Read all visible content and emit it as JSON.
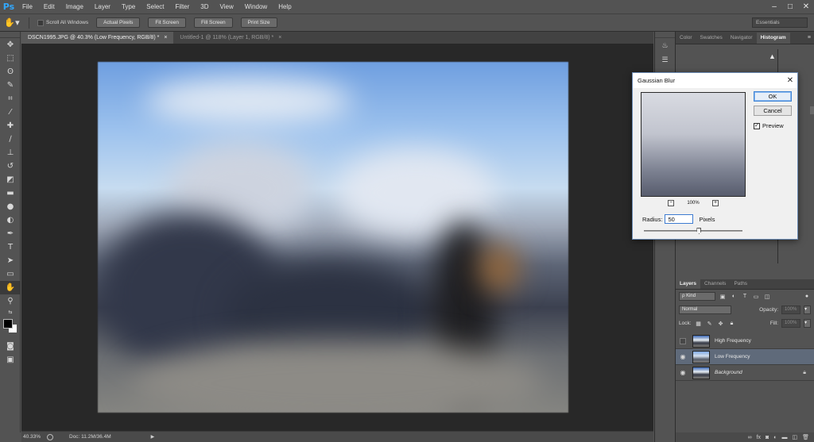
{
  "app": {
    "logo": "Ps",
    "menu": [
      "File",
      "Edit",
      "Image",
      "Layer",
      "Type",
      "Select",
      "Filter",
      "3D",
      "View",
      "Window",
      "Help"
    ],
    "window_controls": [
      "–",
      "□",
      "✕"
    ]
  },
  "options_bar": {
    "scroll_all_windows": "Scroll All Windows",
    "buttons": [
      "Actual Pixels",
      "Fit Screen",
      "Fill Screen",
      "Print Size"
    ],
    "workspace": "Essentials"
  },
  "doc_tabs": [
    {
      "label": "DSCN1995.JPG @ 40.3% (Low Frequency, RGB/8) *",
      "active": true
    },
    {
      "label": "Untitled-1 @ 118% (Layer 1, RGB/8) *",
      "active": false
    }
  ],
  "status": {
    "zoom": "40.33%",
    "doc": "Doc: 11.2M/36.4M",
    "arrow": "▶"
  },
  "panels": {
    "top_tabs": [
      "Color",
      "Swatches",
      "Navigator",
      "Histogram"
    ],
    "active_top_tab": "Histogram",
    "layer_tabs": [
      "Layers",
      "Channels",
      "Paths"
    ],
    "active_layer_tab": "Layers",
    "kind_label": "ρ Kind",
    "blend_mode": "Normal",
    "opacity_label": "Opacity:",
    "opacity_value": "100%",
    "lock_label": "Lock:",
    "fill_label": "Fill:",
    "fill_value": "100%",
    "layers": [
      {
        "name": "High Frequency",
        "visible": false,
        "selected": false,
        "locked": false,
        "italic": false
      },
      {
        "name": "Low Frequency",
        "visible": true,
        "selected": true,
        "locked": false,
        "italic": false
      },
      {
        "name": "Background",
        "visible": true,
        "selected": false,
        "locked": true,
        "italic": true
      }
    ],
    "footer_icons": [
      "link-icon",
      "fx-icon",
      "mask-icon",
      "adjustment-icon",
      "folder-icon",
      "new-layer-icon",
      "trash-icon"
    ]
  },
  "dialog": {
    "title": "Gaussian Blur",
    "ok": "OK",
    "cancel": "Cancel",
    "preview_label": "Preview",
    "preview_checked": true,
    "zoom_level": "100%",
    "radius_label": "Radius:",
    "radius_value": "50",
    "unit": "Pixels",
    "slider_fraction": 0.56
  },
  "colors": {
    "ui_bg": "#535353",
    "canvas_bg": "#282828",
    "selected_layer": "#5f6a7a",
    "accent": "#31a8ff"
  }
}
